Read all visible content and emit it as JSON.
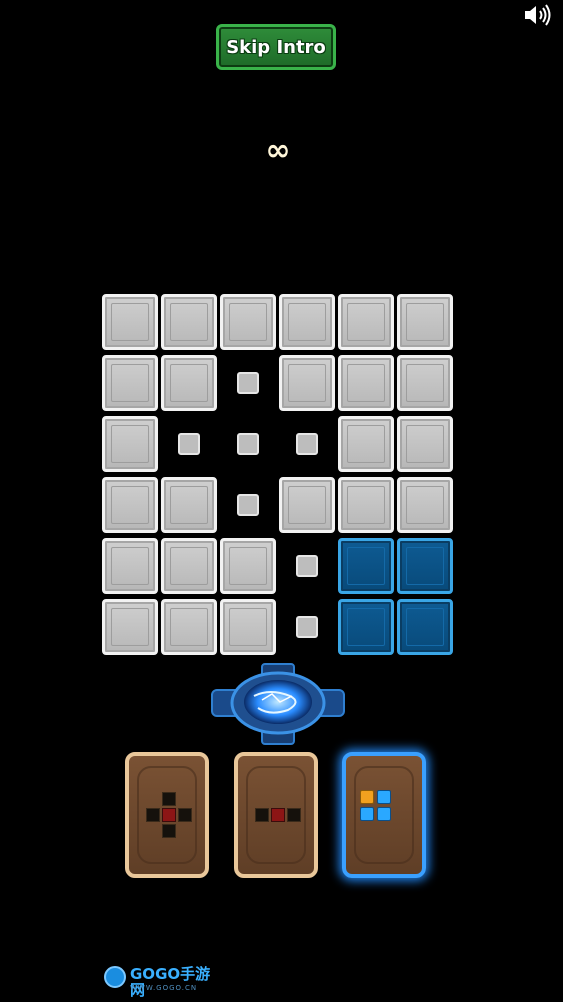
{
  "header": {
    "skip_label": "Skip Intro",
    "sound_icon": "speaker-icon"
  },
  "counter": {
    "value": "∞"
  },
  "board": {
    "rows": 6,
    "cols": 6,
    "cells": [
      [
        "block",
        "block",
        "block",
        "block",
        "block",
        "block"
      ],
      [
        "block",
        "block",
        "dot",
        "block",
        "block",
        "block"
      ],
      [
        "block",
        "dot",
        "dot",
        "dot",
        "block",
        "block"
      ],
      [
        "block",
        "block",
        "dot",
        "block",
        "block",
        "block"
      ],
      [
        "block",
        "block",
        "block",
        "dot",
        "blue",
        "blue"
      ],
      [
        "block",
        "block",
        "block",
        "dot",
        "blue",
        "blue"
      ]
    ]
  },
  "cards": [
    {
      "pattern": "plus",
      "active": false
    },
    {
      "pattern": "line",
      "active": false
    },
    {
      "pattern": "square",
      "active": true
    }
  ],
  "logo": {
    "text": "GOGO手游网",
    "sub": "WWW.GOGO.CN"
  }
}
